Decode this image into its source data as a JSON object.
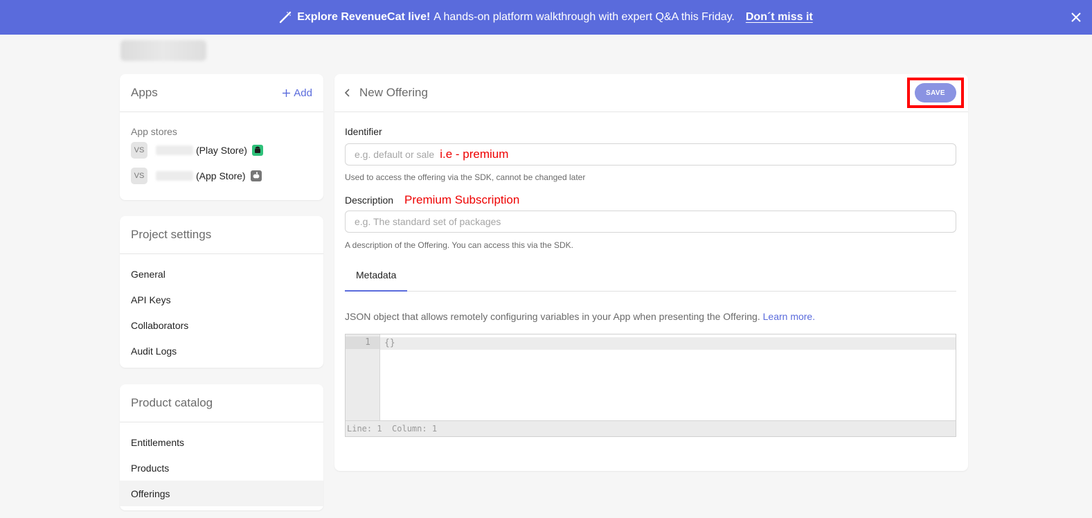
{
  "banner": {
    "strong": "Explore RevenueCat live!",
    "rest": "A hands-on platform walkthrough with expert Q&A this Friday.",
    "cta": "Don´t miss it"
  },
  "apps": {
    "title": "Apps",
    "add_label": "Add",
    "section_label": "App stores",
    "items": [
      {
        "initials": "VS",
        "store": "(Play Store)",
        "icon": "android-icon"
      },
      {
        "initials": "VS",
        "store": "(App Store)",
        "icon": "apple-icon"
      }
    ]
  },
  "project_settings": {
    "title": "Project settings",
    "items": [
      "General",
      "API Keys",
      "Collaborators",
      "Audit Logs"
    ]
  },
  "product_catalog": {
    "title": "Product catalog",
    "items": [
      "Entitlements",
      "Products",
      "Offerings"
    ],
    "active": "Offerings"
  },
  "offering": {
    "title": "New Offering",
    "save_label": "SAVE",
    "identifier": {
      "label": "Identifier",
      "placeholder": "e.g. default or sale",
      "annotation": "i.e - premium",
      "help": "Used to access the offering via the SDK, cannot be changed later"
    },
    "description": {
      "label": "Description",
      "annotation": "Premium Subscription",
      "placeholder": "e.g. The standard set of packages",
      "help": "A description of the Offering. You can access this via the SDK."
    },
    "tab": "Metadata",
    "metadata_desc": "JSON object that allows remotely configuring variables in your App when presenting the Offering.",
    "learn_more": "Learn more.",
    "editor": {
      "line_number": "1",
      "code": "{}",
      "status": "Line: 1  Column: 1"
    }
  },
  "colors": {
    "accent": "#5a6bdc",
    "annotation": "#ee0000",
    "highlight_box": "#ff0000"
  }
}
